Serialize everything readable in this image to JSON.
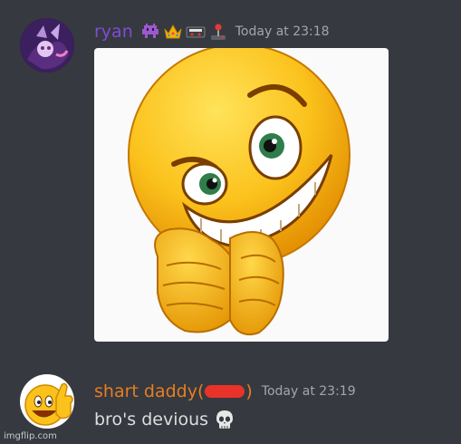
{
  "messages": [
    {
      "username": "ryan",
      "username_color": "#7c4dd8",
      "timestamp": "Today at 23:18",
      "badges": [
        "alien-monster-icon",
        "crown-icon",
        "vhs-tape-icon",
        "joystick-icon"
      ],
      "attachment": "smirking-emoji-image"
    },
    {
      "username": "shart daddy(",
      "username_suffix": ")",
      "username_color": "#e67e22",
      "redaction_color": "#e8322a",
      "timestamp": "Today at 23:19",
      "text": "bro's devious",
      "trailing_emoji": "skull-icon"
    }
  ],
  "watermark": "imgflip.com"
}
